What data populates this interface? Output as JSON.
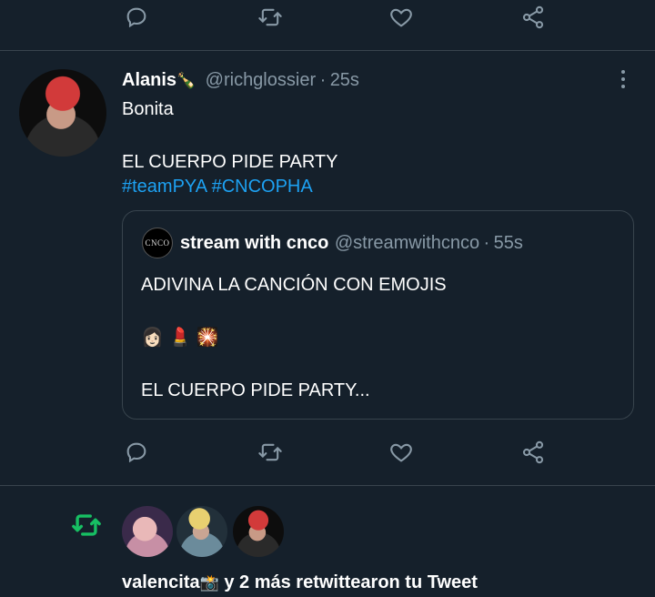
{
  "tweet": {
    "author_name": "Alanis",
    "author_handle": "@richglossier",
    "time": "25s",
    "name_emoji": "🍾",
    "line1": "Bonita",
    "line2": "EL CUERPO PIDE PARTY",
    "hashtags": [
      "#teamPYA",
      "#CNCOPHA"
    ],
    "avatar_icon": "user-avatar-red-hair"
  },
  "quote": {
    "author_name": "stream with cnco",
    "author_handle": "@streamwithcnco",
    "time": "55s",
    "avatar_text": "CNCO",
    "line1": "ADIVINA LA CANCIÓN CON EMOJIS",
    "emojis": "👩🏻 💄 🎇",
    "line3": "EL CUERPO PIDE PARTY..."
  },
  "actions": [
    "reply-icon",
    "retweet-icon",
    "like-icon",
    "share-icon"
  ],
  "notification": {
    "text_name": "valencita",
    "name_emoji": "📸",
    "text_rest": " y 2 más retwittearon tu Tweet",
    "icon": "retweet-icon",
    "accent": "#17bf63"
  },
  "colors": {
    "background": "#15202b",
    "secondary_text": "#8899a6",
    "link": "#1da1f2",
    "border": "#38444d"
  }
}
